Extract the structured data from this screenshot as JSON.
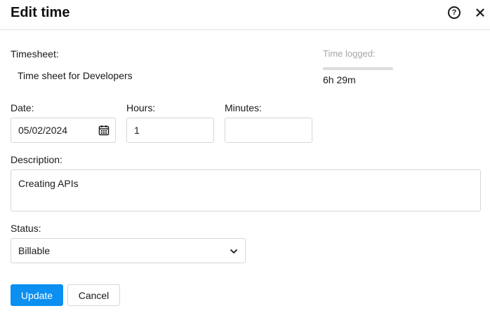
{
  "dialog": {
    "title": "Edit time",
    "help_symbol": "?"
  },
  "timesheet": {
    "label": "Timesheet:",
    "value": "Time sheet for Developers"
  },
  "time_logged": {
    "label": "Time logged:",
    "value": "6h 29m",
    "progress_fraction": 1.0
  },
  "date": {
    "label": "Date:",
    "value": "05/02/2024"
  },
  "hours": {
    "label": "Hours:",
    "value": "1"
  },
  "minutes": {
    "label": "Minutes:",
    "value": ""
  },
  "description": {
    "label": "Description:",
    "value": "Creating APIs"
  },
  "status": {
    "label": "Status:",
    "value": "Billable"
  },
  "actions": {
    "update_label": "Update",
    "cancel_label": "Cancel"
  },
  "colors": {
    "primary": "#0b8ff0",
    "border": "#d6d6d6",
    "muted_text": "#a6a6a6"
  },
  "icons": {
    "help": "question-circle-icon",
    "close": "close-icon",
    "date": "calendar-icon",
    "status": "chevron-down-icon"
  }
}
